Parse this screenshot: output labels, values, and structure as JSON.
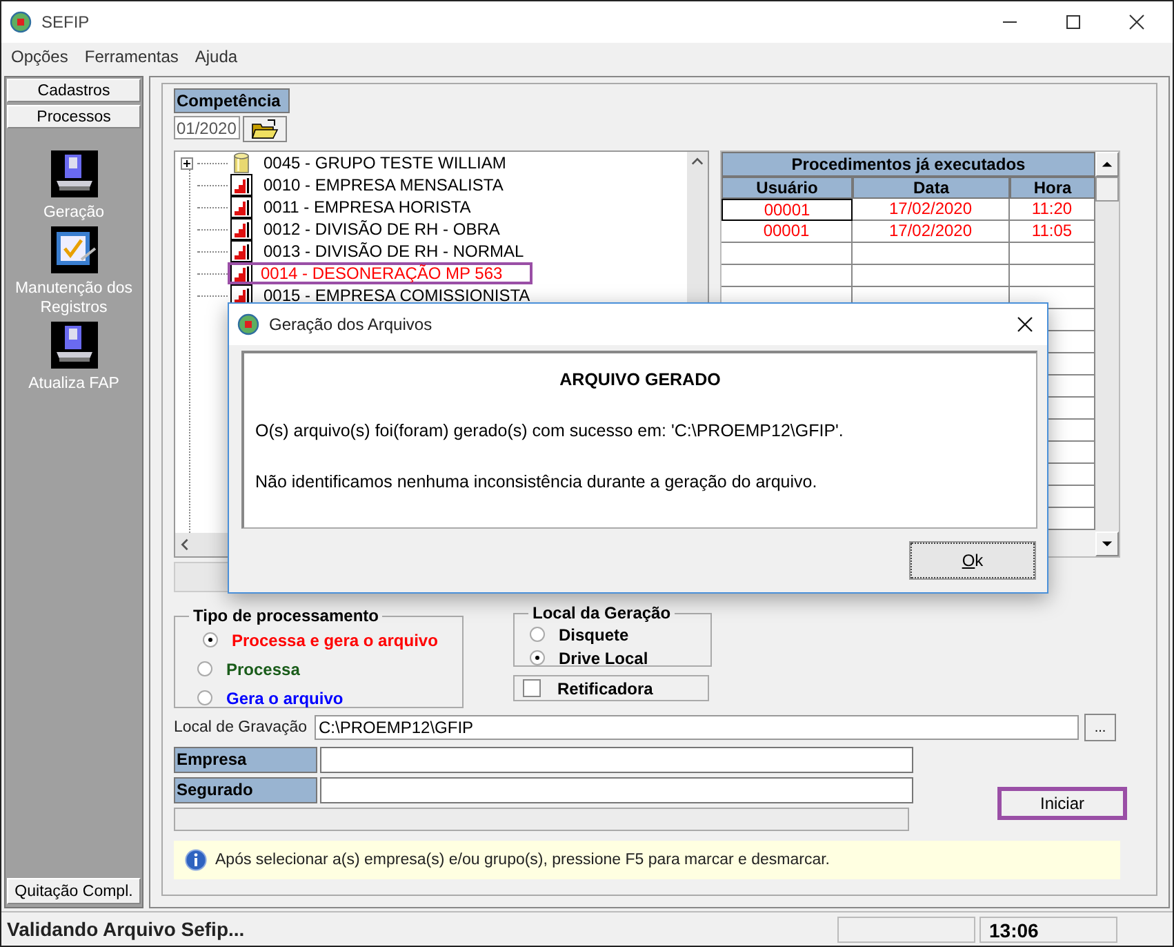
{
  "window": {
    "title": "SEFIP"
  },
  "menu": [
    "Opções",
    "Ferramentas",
    "Ajuda"
  ],
  "sidebar": {
    "tabs": [
      {
        "label": "Cadastros"
      },
      {
        "label": "Processos"
      }
    ],
    "tools": [
      {
        "label": "Geração",
        "kind": "disk"
      },
      {
        "label": "Manutenção dos Registros",
        "kind": "check"
      },
      {
        "label": "Atualiza FAP",
        "kind": "disk"
      }
    ],
    "bottom_button": "Quitação Compl."
  },
  "competencia": {
    "label": "Competência",
    "value": "01/2020"
  },
  "tree": [
    {
      "label": "0045 - GRUPO TESTE WILLIAM",
      "kind": "group",
      "expanded": false,
      "marked": false,
      "highlighted": false
    },
    {
      "label": "0010 - EMPRESA MENSALISTA",
      "kind": "company",
      "marked": false,
      "highlighted": false
    },
    {
      "label": "0011 - EMPRESA HORISTA",
      "kind": "company",
      "marked": false,
      "highlighted": false
    },
    {
      "label": "0012 - DIVISÃO DE RH - OBRA",
      "kind": "company",
      "marked": false,
      "highlighted": false
    },
    {
      "label": "0013 - DIVISÃO DE RH - NORMAL",
      "kind": "company",
      "marked": false,
      "highlighted": false
    },
    {
      "label": "0014 - DESONERAÇÃO MP 563",
      "kind": "company",
      "marked": true,
      "highlighted": true
    },
    {
      "label": "0015 - EMPRESA COMISSIONISTA",
      "kind": "company",
      "marked": false,
      "highlighted": false
    }
  ],
  "procedures": {
    "title": "Procedimentos já executados",
    "columns": [
      "Usuário",
      "Data",
      "Hora"
    ],
    "rows": [
      [
        "00001",
        "17/02/2020",
        "11:20"
      ],
      [
        "00001",
        "17/02/2020",
        "11:05"
      ]
    ]
  },
  "tipo": {
    "title": "Tipo de processamento",
    "options": [
      {
        "label": "Processa e gera o arquivo",
        "selected": true,
        "color": "#ff0000"
      },
      {
        "label": "Processa",
        "selected": false,
        "color": "#1a5c1a"
      },
      {
        "label": "Gera o arquivo",
        "selected": false,
        "color": "#0000ff"
      }
    ]
  },
  "local_geracao": {
    "title": "Local da Geração",
    "options": [
      {
        "label": "Disquete",
        "selected": false
      },
      {
        "label": "Drive Local",
        "selected": true
      }
    ]
  },
  "retificadora": {
    "label": "Retificadora",
    "checked": false
  },
  "gravacao": {
    "label": "Local de Gravação",
    "value": "C:\\PROEMP12\\GFIP",
    "browse": "..."
  },
  "empresa_label": "Empresa",
  "segurado_label": "Segurado",
  "progress": {
    "level": 0
  },
  "start_button": {
    "label": "Iniciar",
    "highlighted": true
  },
  "info": "Após selecionar a(s) empresa(s) e/ou grupo(s), pressione F5 para marcar e desmarcar.",
  "status_bar": {
    "message": "Validando Arquivo Sefip...",
    "time": "13:06"
  },
  "dialog": {
    "title": "Geração dos Arquivos",
    "heading": "ARQUIVO GERADO",
    "lines": [
      "O(s) arquivo(s) foi(foram) gerado(s) com sucesso em: 'C:\\PROEMP12\\GFIP'.",
      "Não identificamos nenhuma inconsistência durante a geração do arquivo."
    ],
    "ok": "Ok"
  }
}
